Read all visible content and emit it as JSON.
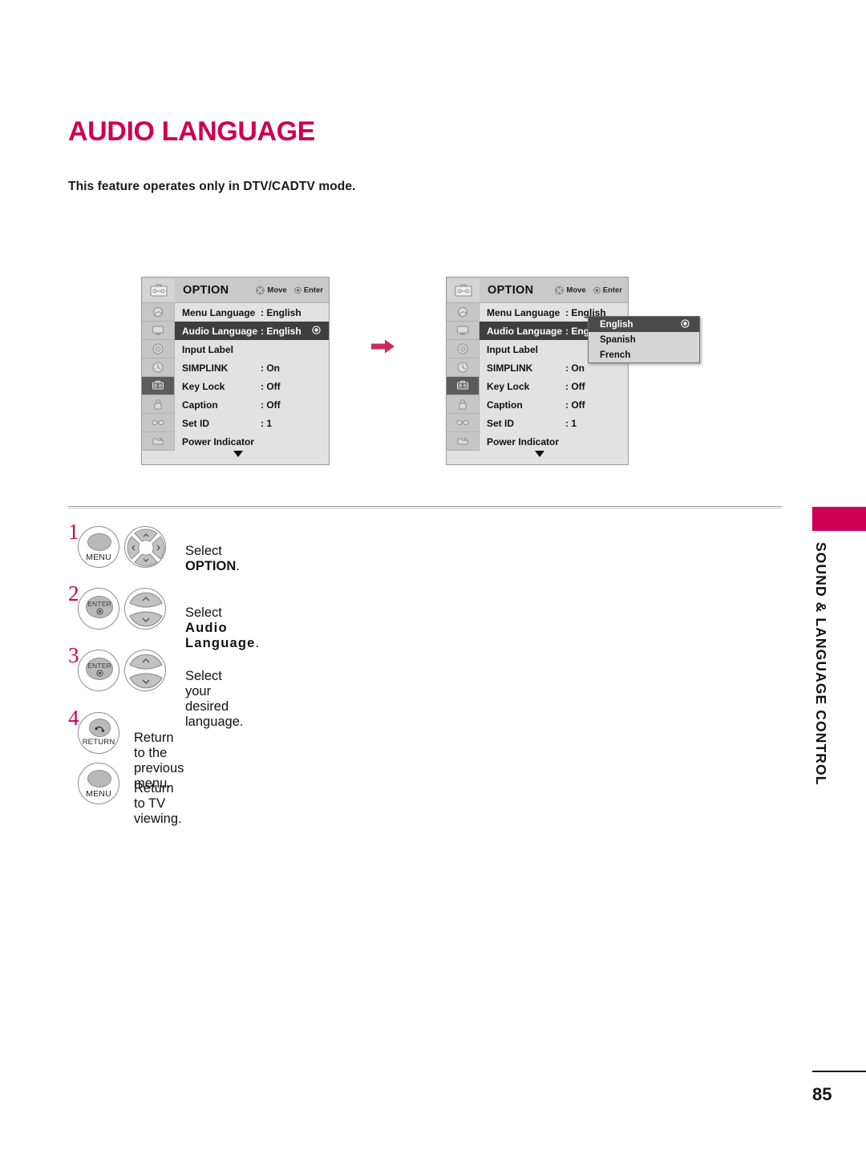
{
  "document": {
    "title": "AUDIO LANGUAGE",
    "subtitle": "This feature operates only in DTV/CADTV mode.",
    "page_number": "85",
    "side_tab_label": "SOUND & LANGUAGE CONTROL",
    "accent_color": "#cc0055"
  },
  "osd_before": {
    "title": "OPTION",
    "hints": [
      {
        "icon": "dpad-move-icon",
        "label": "Move"
      },
      {
        "icon": "enter-circle-icon",
        "label": "Enter"
      }
    ],
    "icon_column": [
      {
        "name": "picture-icon",
        "selected": false
      },
      {
        "name": "display-icon",
        "selected": false
      },
      {
        "name": "audio-icon",
        "selected": false
      },
      {
        "name": "time-icon",
        "selected": false
      },
      {
        "name": "option-icon",
        "selected": true
      },
      {
        "name": "lock-icon",
        "selected": false
      },
      {
        "name": "input-icon",
        "selected": false
      },
      {
        "name": "usb-icon",
        "selected": false
      }
    ],
    "rows": [
      {
        "label": "Menu Language",
        "value": ": English",
        "highlighted": false,
        "dot": false
      },
      {
        "label": "Audio Language",
        "value": ": English",
        "highlighted": true,
        "dot": true
      },
      {
        "label": "Input Label",
        "value": "",
        "highlighted": false,
        "dot": false
      },
      {
        "label": "SIMPLINK",
        "value": ": On",
        "highlighted": false,
        "dot": false
      },
      {
        "label": "Key Lock",
        "value": ": Off",
        "highlighted": false,
        "dot": false
      },
      {
        "label": "Caption",
        "value": ": Off",
        "highlighted": false,
        "dot": false
      },
      {
        "label": "Set ID",
        "value": ": 1",
        "highlighted": false,
        "dot": false
      },
      {
        "label": "Power Indicator",
        "value": "",
        "highlighted": false,
        "dot": false
      }
    ],
    "scroll_indicator": "down-triangle-icon"
  },
  "osd_after": {
    "title": "OPTION",
    "hints": [
      {
        "icon": "dpad-move-icon",
        "label": "Move"
      },
      {
        "icon": "enter-circle-icon",
        "label": "Enter"
      }
    ],
    "icon_column": [
      {
        "name": "picture-icon",
        "selected": false
      },
      {
        "name": "display-icon",
        "selected": false
      },
      {
        "name": "audio-icon",
        "selected": false
      },
      {
        "name": "time-icon",
        "selected": false
      },
      {
        "name": "option-icon",
        "selected": true
      },
      {
        "name": "lock-icon",
        "selected": false
      },
      {
        "name": "input-icon",
        "selected": false
      },
      {
        "name": "usb-icon",
        "selected": false
      }
    ],
    "rows": [
      {
        "label": "Menu Language",
        "value": ": English",
        "highlighted": false,
        "dot": false
      },
      {
        "label": "Audio Language",
        "value": ": Eng",
        "highlighted": true,
        "dot": false
      },
      {
        "label": "Input Label",
        "value": "",
        "highlighted": false,
        "dot": false
      },
      {
        "label": "SIMPLINK",
        "value": ": On",
        "highlighted": false,
        "dot": false
      },
      {
        "label": "Key Lock",
        "value": ": Off",
        "highlighted": false,
        "dot": false
      },
      {
        "label": "Caption",
        "value": ": Off",
        "highlighted": false,
        "dot": false
      },
      {
        "label": "Set ID",
        "value": ": 1",
        "highlighted": false,
        "dot": false
      },
      {
        "label": "Power Indicator",
        "value": "",
        "highlighted": false,
        "dot": false
      }
    ],
    "scroll_indicator": "down-triangle-icon",
    "dropdown": {
      "items": [
        {
          "label": "English",
          "selected": true
        },
        {
          "label": "Spanish",
          "selected": false
        },
        {
          "label": "French",
          "selected": false
        }
      ]
    }
  },
  "flow": {
    "arrow_icon": "right-arrow-icon"
  },
  "steps": [
    {
      "number": "1",
      "buttons": [
        {
          "name": "menu-button",
          "label": "MENU",
          "type": "round"
        },
        {
          "name": "navigation-dpad",
          "label": "",
          "type": "dpad4"
        }
      ],
      "text_plain": "Select ",
      "text_bold": "OPTION",
      "text_tail": ".",
      "bold_spaced": false
    },
    {
      "number": "2",
      "buttons": [
        {
          "name": "enter-button",
          "label": "ENTER",
          "type": "enter"
        },
        {
          "name": "updown-button",
          "label": "",
          "type": "updown"
        }
      ],
      "text_plain": "Select ",
      "text_bold": "Audio Language",
      "text_tail": ".",
      "bold_spaced": true
    },
    {
      "number": "3",
      "buttons": [
        {
          "name": "enter-button",
          "label": "ENTER",
          "type": "enter"
        },
        {
          "name": "updown-button",
          "label": "",
          "type": "updown"
        }
      ],
      "text_plain": "Select your desired language.",
      "text_bold": "",
      "text_tail": "",
      "bold_spaced": false
    },
    {
      "number": "4",
      "buttons": [
        {
          "name": "return-button",
          "label": "RETURN",
          "type": "return"
        }
      ],
      "text_plain": "Return to the previous menu.",
      "text_bold": "",
      "text_tail": "",
      "bold_spaced": false
    },
    {
      "number": "",
      "buttons": [
        {
          "name": "menu-button",
          "label": "MENU",
          "type": "round"
        }
      ],
      "text_plain": "Return to TV viewing.",
      "text_bold": "",
      "text_tail": "",
      "bold_spaced": false
    }
  ]
}
